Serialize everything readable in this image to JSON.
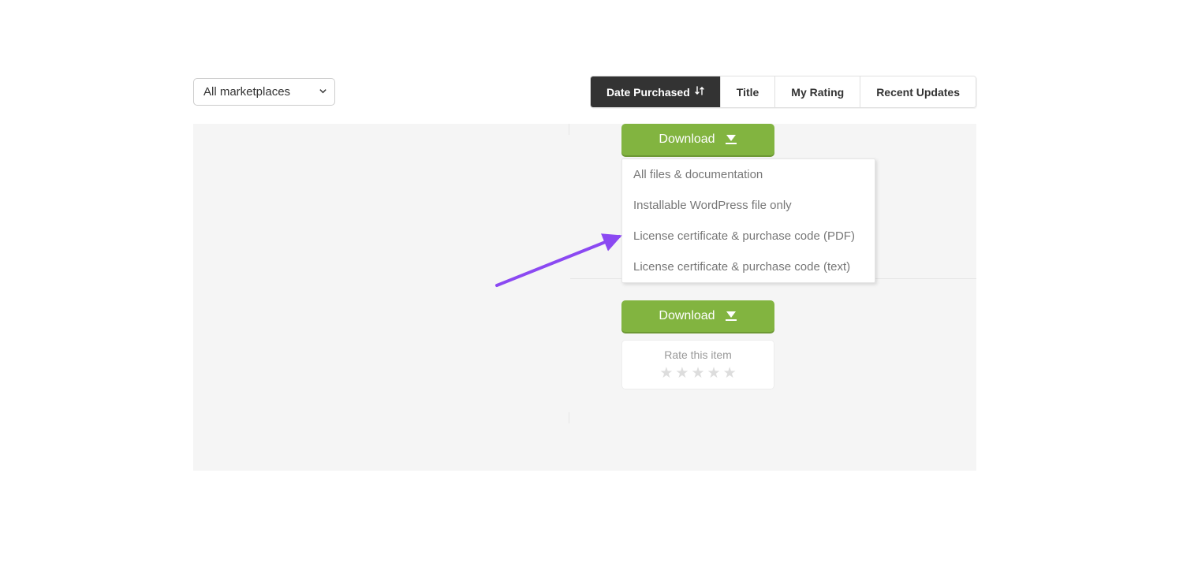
{
  "toolbar": {
    "marketplace_select": "All marketplaces",
    "sort_tabs": [
      {
        "label": "Date Purchased",
        "active": true,
        "has_sort_icon": true
      },
      {
        "label": "Title",
        "active": false
      },
      {
        "label": "My Rating",
        "active": false
      },
      {
        "label": "Recent Updates",
        "active": false
      }
    ]
  },
  "items": [
    {
      "download_label": "Download",
      "dropdown_open": true,
      "dropdown_options": [
        "All files & documentation",
        "Installable WordPress file only",
        "License certificate & purchase code (PDF)",
        "License certificate & purchase code (text)"
      ]
    },
    {
      "download_label": "Download",
      "dropdown_open": false,
      "rate_label": "Rate this item"
    }
  ],
  "annotation": {
    "arrow_color": "#8b49f2"
  }
}
